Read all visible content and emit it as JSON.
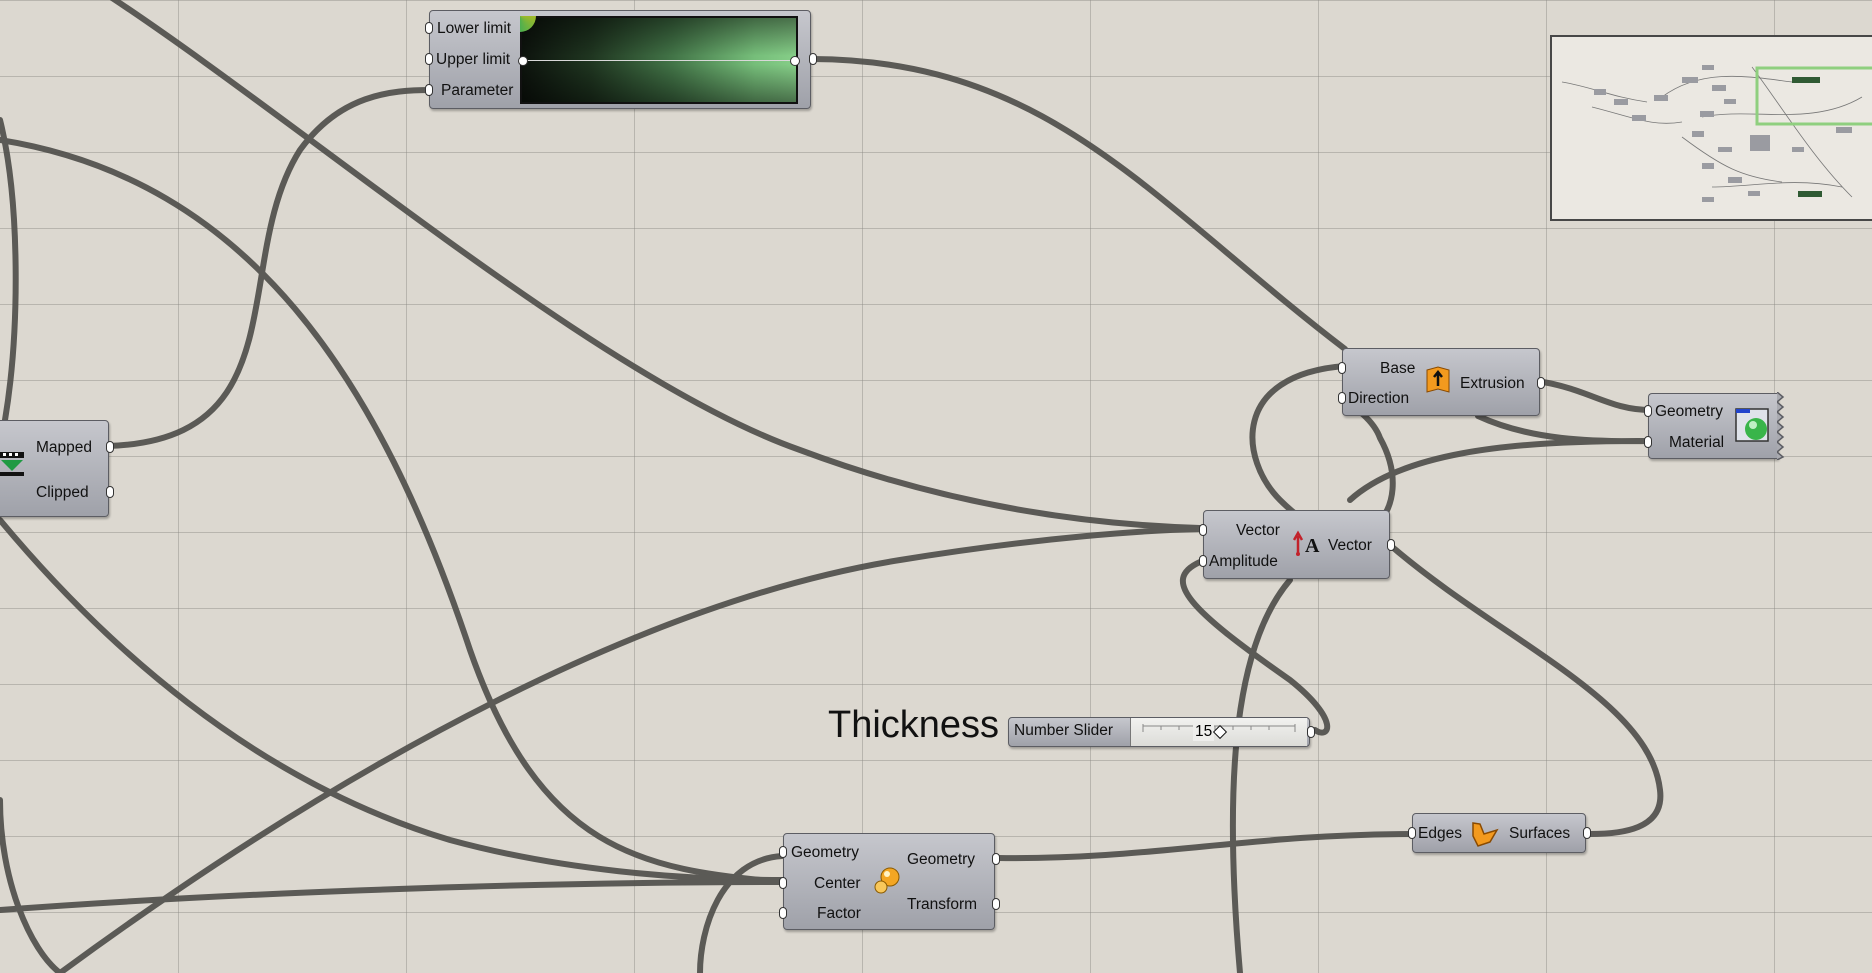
{
  "gradient_node": {
    "inputs": [
      "Lower limit",
      "Upper limit",
      "Parameter"
    ]
  },
  "remap_node": {
    "outputs": [
      "Mapped",
      "Clipped"
    ]
  },
  "extrude_node": {
    "inputs": [
      "Base",
      "Direction"
    ],
    "outputs": [
      "Extrusion"
    ]
  },
  "preview_node": {
    "inputs": [
      "Geometry",
      "Material"
    ]
  },
  "amplitude_node": {
    "inputs": [
      "Vector",
      "Amplitude"
    ],
    "outputs": [
      "Vector"
    ]
  },
  "slider": {
    "label": "Thickness",
    "type_label": "Number Slider",
    "value": "15",
    "value_fraction": 0.5
  },
  "scale_node": {
    "inputs": [
      "Geometry",
      "Center",
      "Factor"
    ],
    "outputs": [
      "Geometry",
      "Transform"
    ]
  },
  "boundary_node": {
    "inputs": [
      "Edges"
    ],
    "outputs": [
      "Surfaces"
    ]
  },
  "colors": {
    "canvas": "#dcd8d0",
    "wire": "#4e4d49",
    "node": "#b4b5bb",
    "gradient_end": "#86ce88",
    "minimap_viewport": "#8fcf7f"
  },
  "icons": [
    "gradient-icon",
    "remap-icon",
    "extrude-icon",
    "preview-icon",
    "amplitude-icon",
    "scale-icon",
    "boundary-surfaces-icon"
  ]
}
